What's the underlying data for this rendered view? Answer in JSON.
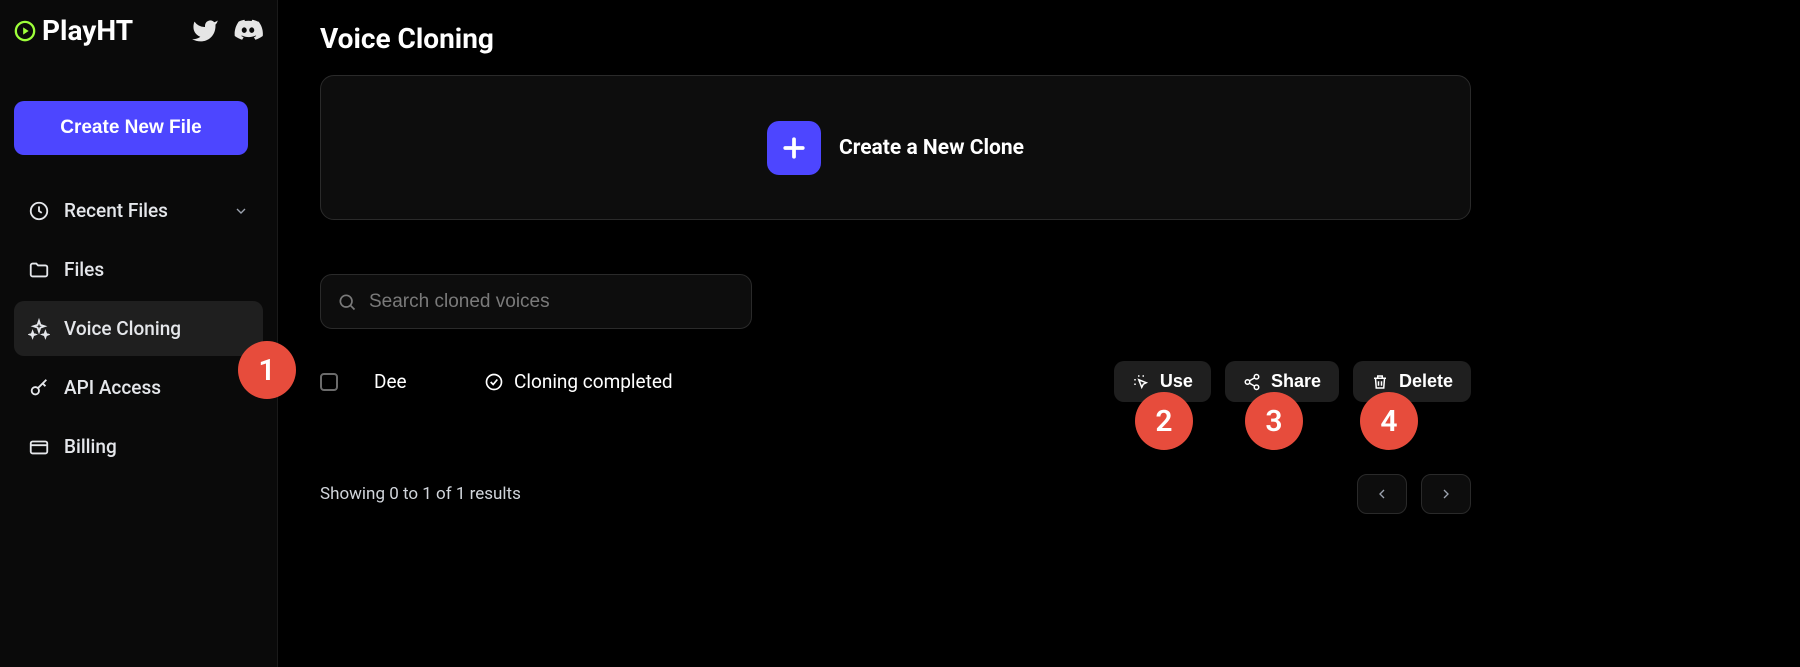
{
  "brand": "PlayHT",
  "sidebar": {
    "create_button": "Create New File",
    "items": [
      {
        "label": "Recent Files",
        "icon": "clock",
        "expandable": true
      },
      {
        "label": "Files",
        "icon": "folder"
      },
      {
        "label": "Voice Cloning",
        "icon": "sparkles",
        "active": true
      },
      {
        "label": "API Access",
        "icon": "key"
      },
      {
        "label": "Billing",
        "icon": "card"
      }
    ]
  },
  "page": {
    "title": "Voice Cloning",
    "create_clone": "Create a New Clone",
    "search_placeholder": "Search cloned voices"
  },
  "rows": [
    {
      "name": "Dee",
      "status": "Cloning completed"
    }
  ],
  "actions": {
    "use": "Use",
    "share": "Share",
    "delete": "Delete"
  },
  "results_text": "Showing 0 to 1 of 1 results",
  "annotations": [
    "1",
    "2",
    "3",
    "4"
  ]
}
